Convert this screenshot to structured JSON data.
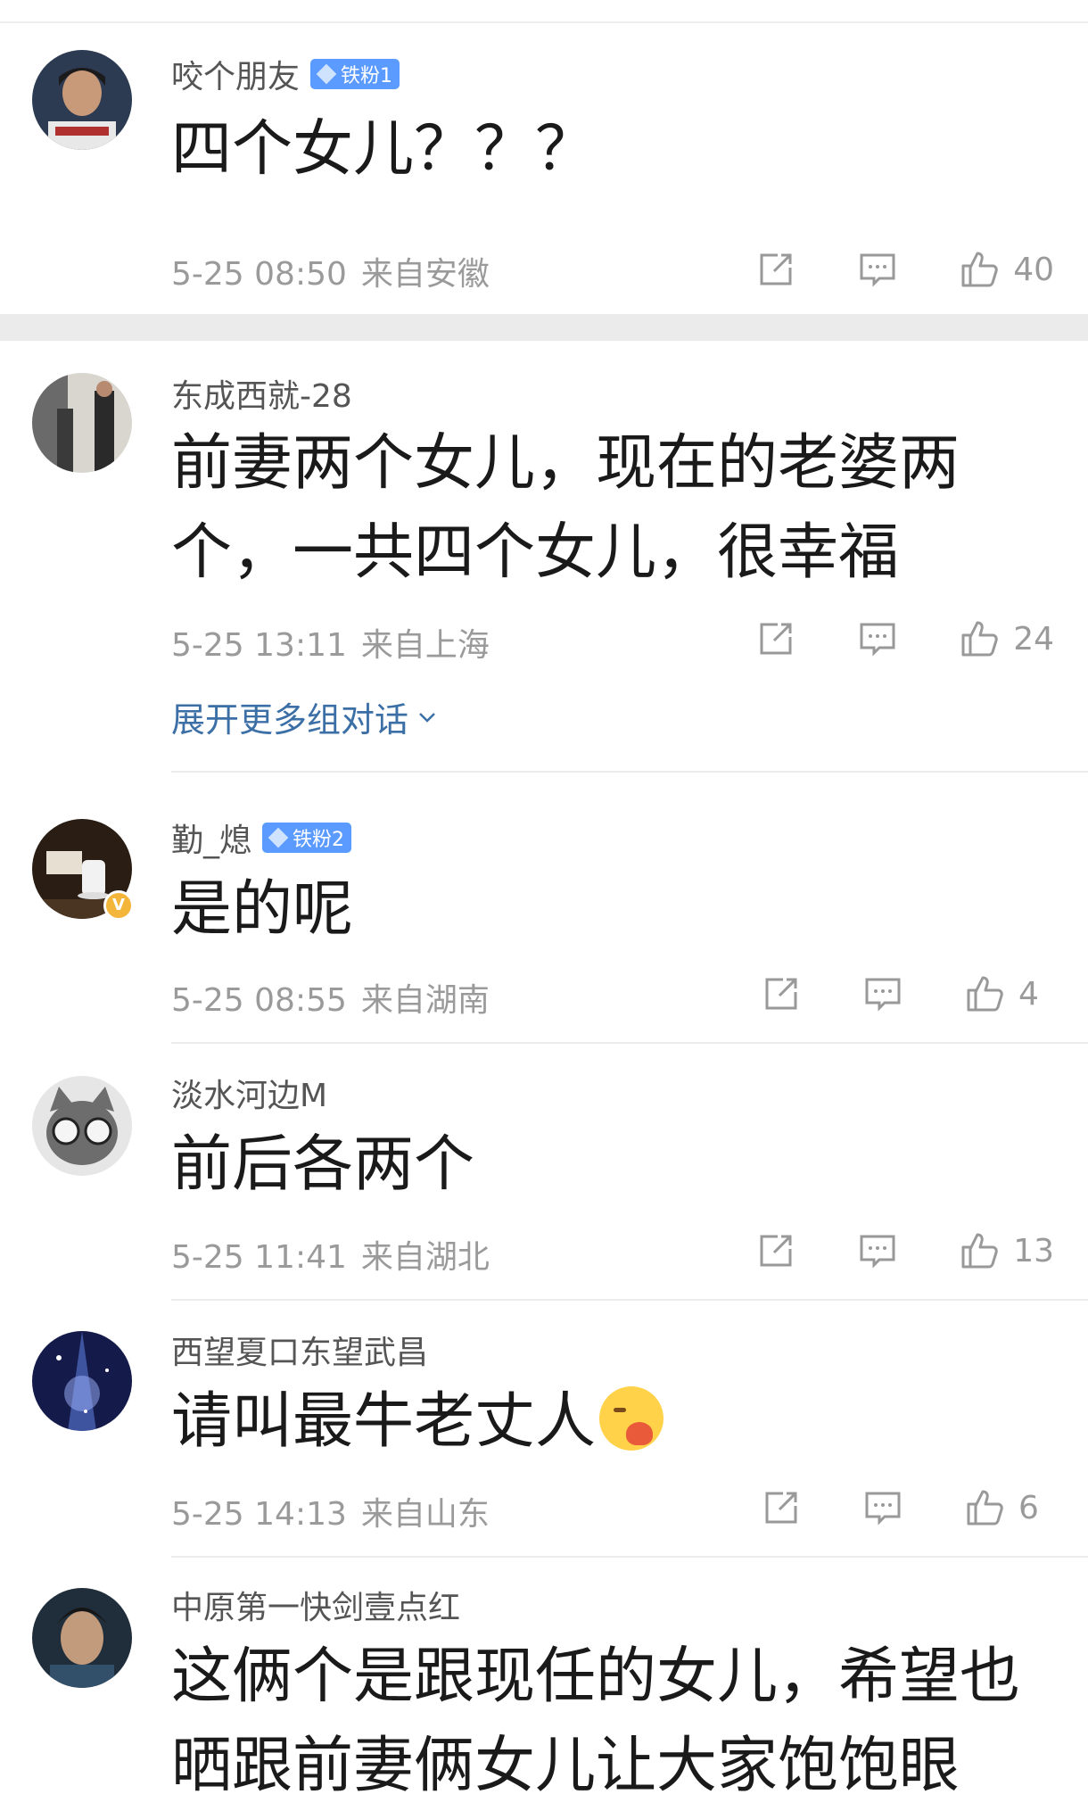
{
  "colors": {
    "badge_blue": "#5b9bff",
    "link_blue": "#3b6fa6",
    "meta_gray": "#9a9a9a"
  },
  "icons": {
    "share": "share-icon",
    "comment": "comment-icon",
    "like": "thumbs-up-icon"
  },
  "comments": [
    {
      "username": "咬个朋友",
      "badge": "铁粉1",
      "text": "四个女儿？？？",
      "date": "5-25 08:50",
      "location": "来自安徽",
      "likes": "40"
    },
    {
      "username": "东成西就-28",
      "text_line1": "前妻两个女儿，现在的老婆两",
      "text_line2": "个，一共四个女儿，很幸福",
      "date": "5-25 13:11",
      "location": "来自上海",
      "likes": "24",
      "expand_label": "展开更多组对话"
    },
    {
      "username": "勤_熄",
      "badge": "铁粉2",
      "text": "是的呢",
      "date": "5-25 08:55",
      "location": "来自湖南",
      "likes": "4"
    },
    {
      "username": "淡水河边M",
      "text": "前后各两个",
      "date": "5-25 11:41",
      "location": "来自湖北",
      "likes": "13"
    },
    {
      "username": "西望夏口东望武昌",
      "text": "请叫最牛老丈人",
      "date": "5-25 14:13",
      "location": "来自山东",
      "likes": "6"
    },
    {
      "username": "中原第一快剑壹点红",
      "text_line1": "这俩个是跟现任的女儿，希望也",
      "text_line2": "晒跟前妻俩女儿让大家饱饱眼"
    }
  ]
}
